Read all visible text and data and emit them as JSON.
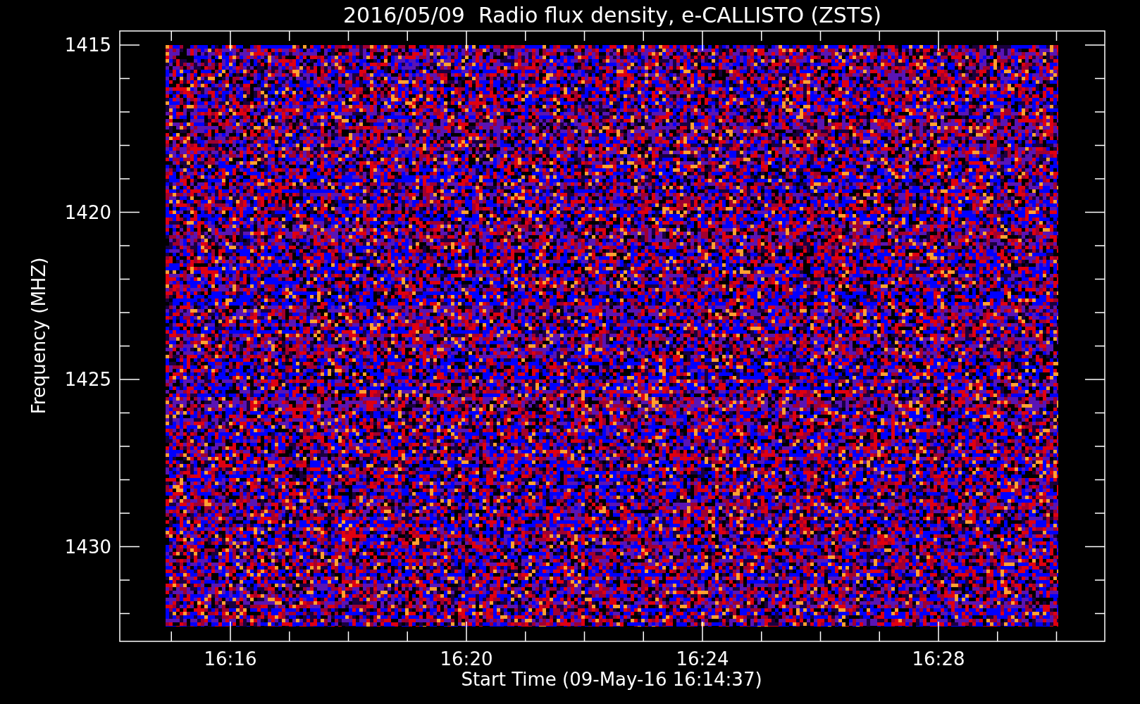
{
  "title": "2016/05/09  Radio flux density, e-CALLISTO (ZSTS)",
  "plot": {
    "ylabel": "Frequency (MHZ)",
    "xlabel": "Start Time (09-May-16 16:14:37)",
    "yticks": [
      "1415",
      "1420",
      "1425",
      "1430"
    ],
    "xticks": [
      "16:16",
      "16:20",
      "16:24",
      "16:28"
    ]
  }
}
